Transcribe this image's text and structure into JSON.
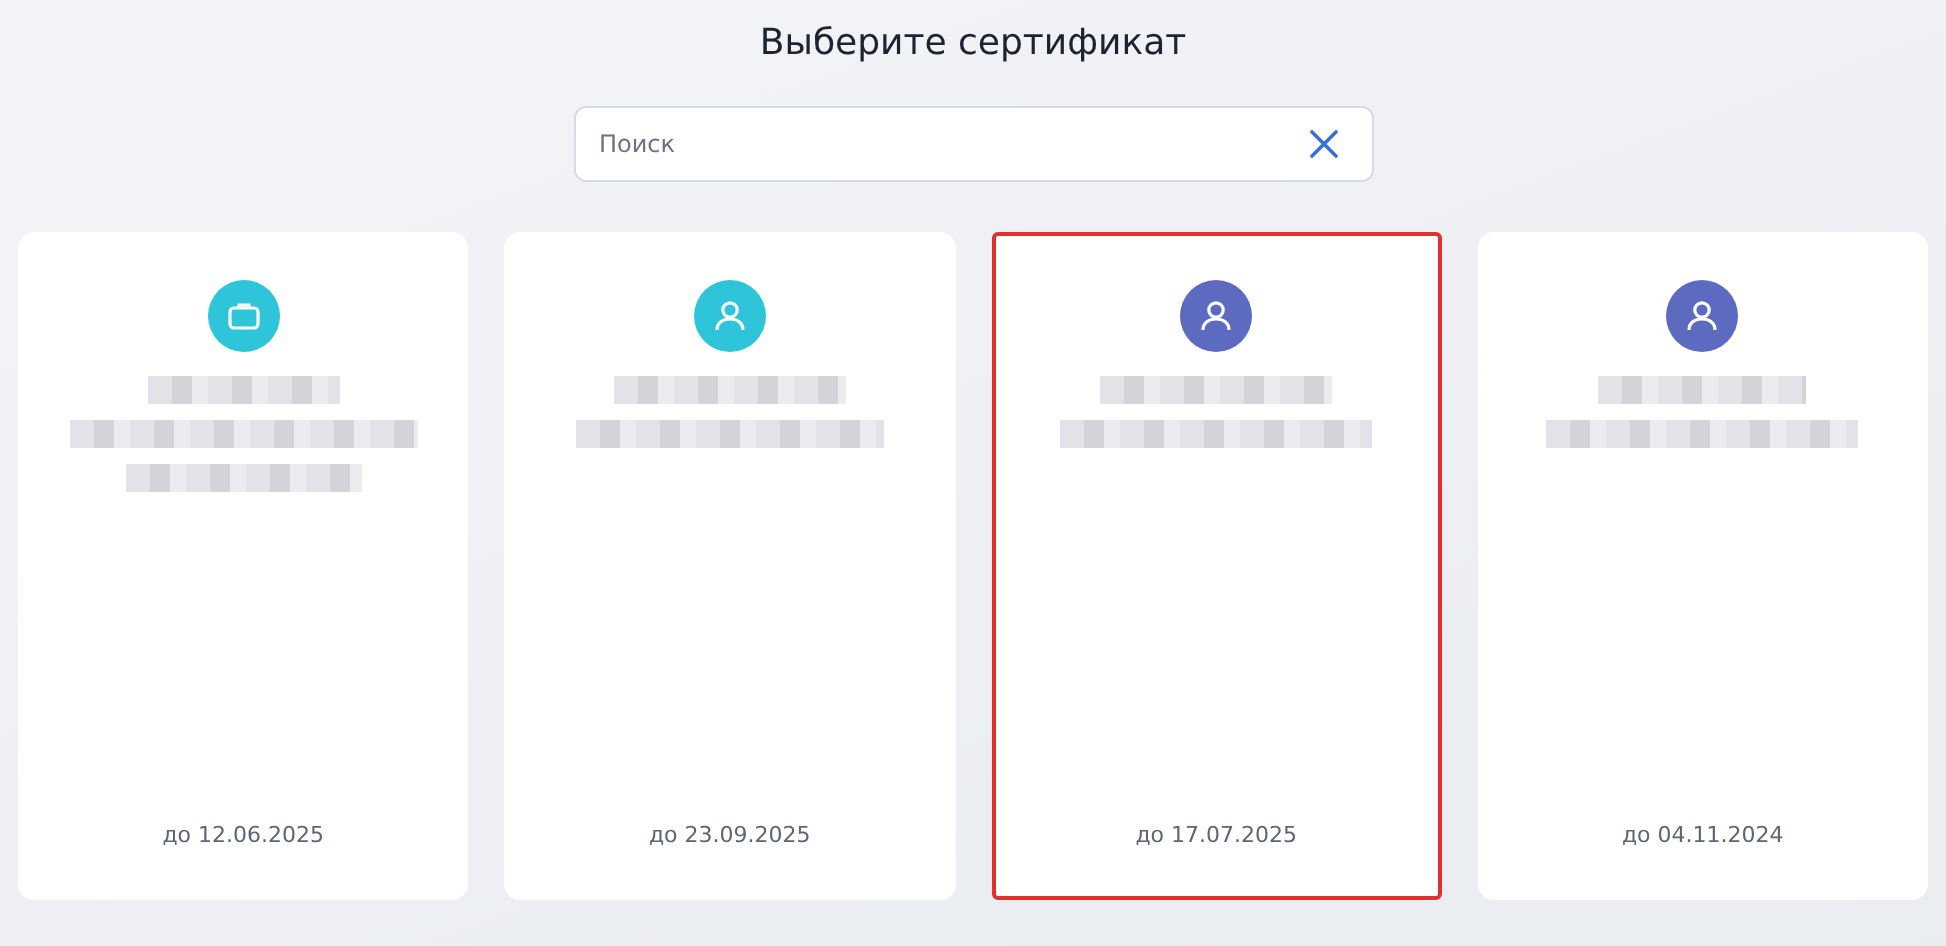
{
  "title": "Выберите сертификат",
  "search": {
    "placeholder": "Поиск"
  },
  "certificates": [
    {
      "kind": "organization",
      "color": "#2ec4d9",
      "valid_until": "до 12.06.2025",
      "selected": false
    },
    {
      "kind": "person",
      "color": "#2ec4d9",
      "valid_until": "до 23.09.2025",
      "selected": false
    },
    {
      "kind": "person",
      "color": "#5c6bc0",
      "valid_until": "до 17.07.2025",
      "selected": true
    },
    {
      "kind": "person",
      "color": "#5c6bc0",
      "valid_until": "до 04.11.2024",
      "selected": false
    }
  ]
}
